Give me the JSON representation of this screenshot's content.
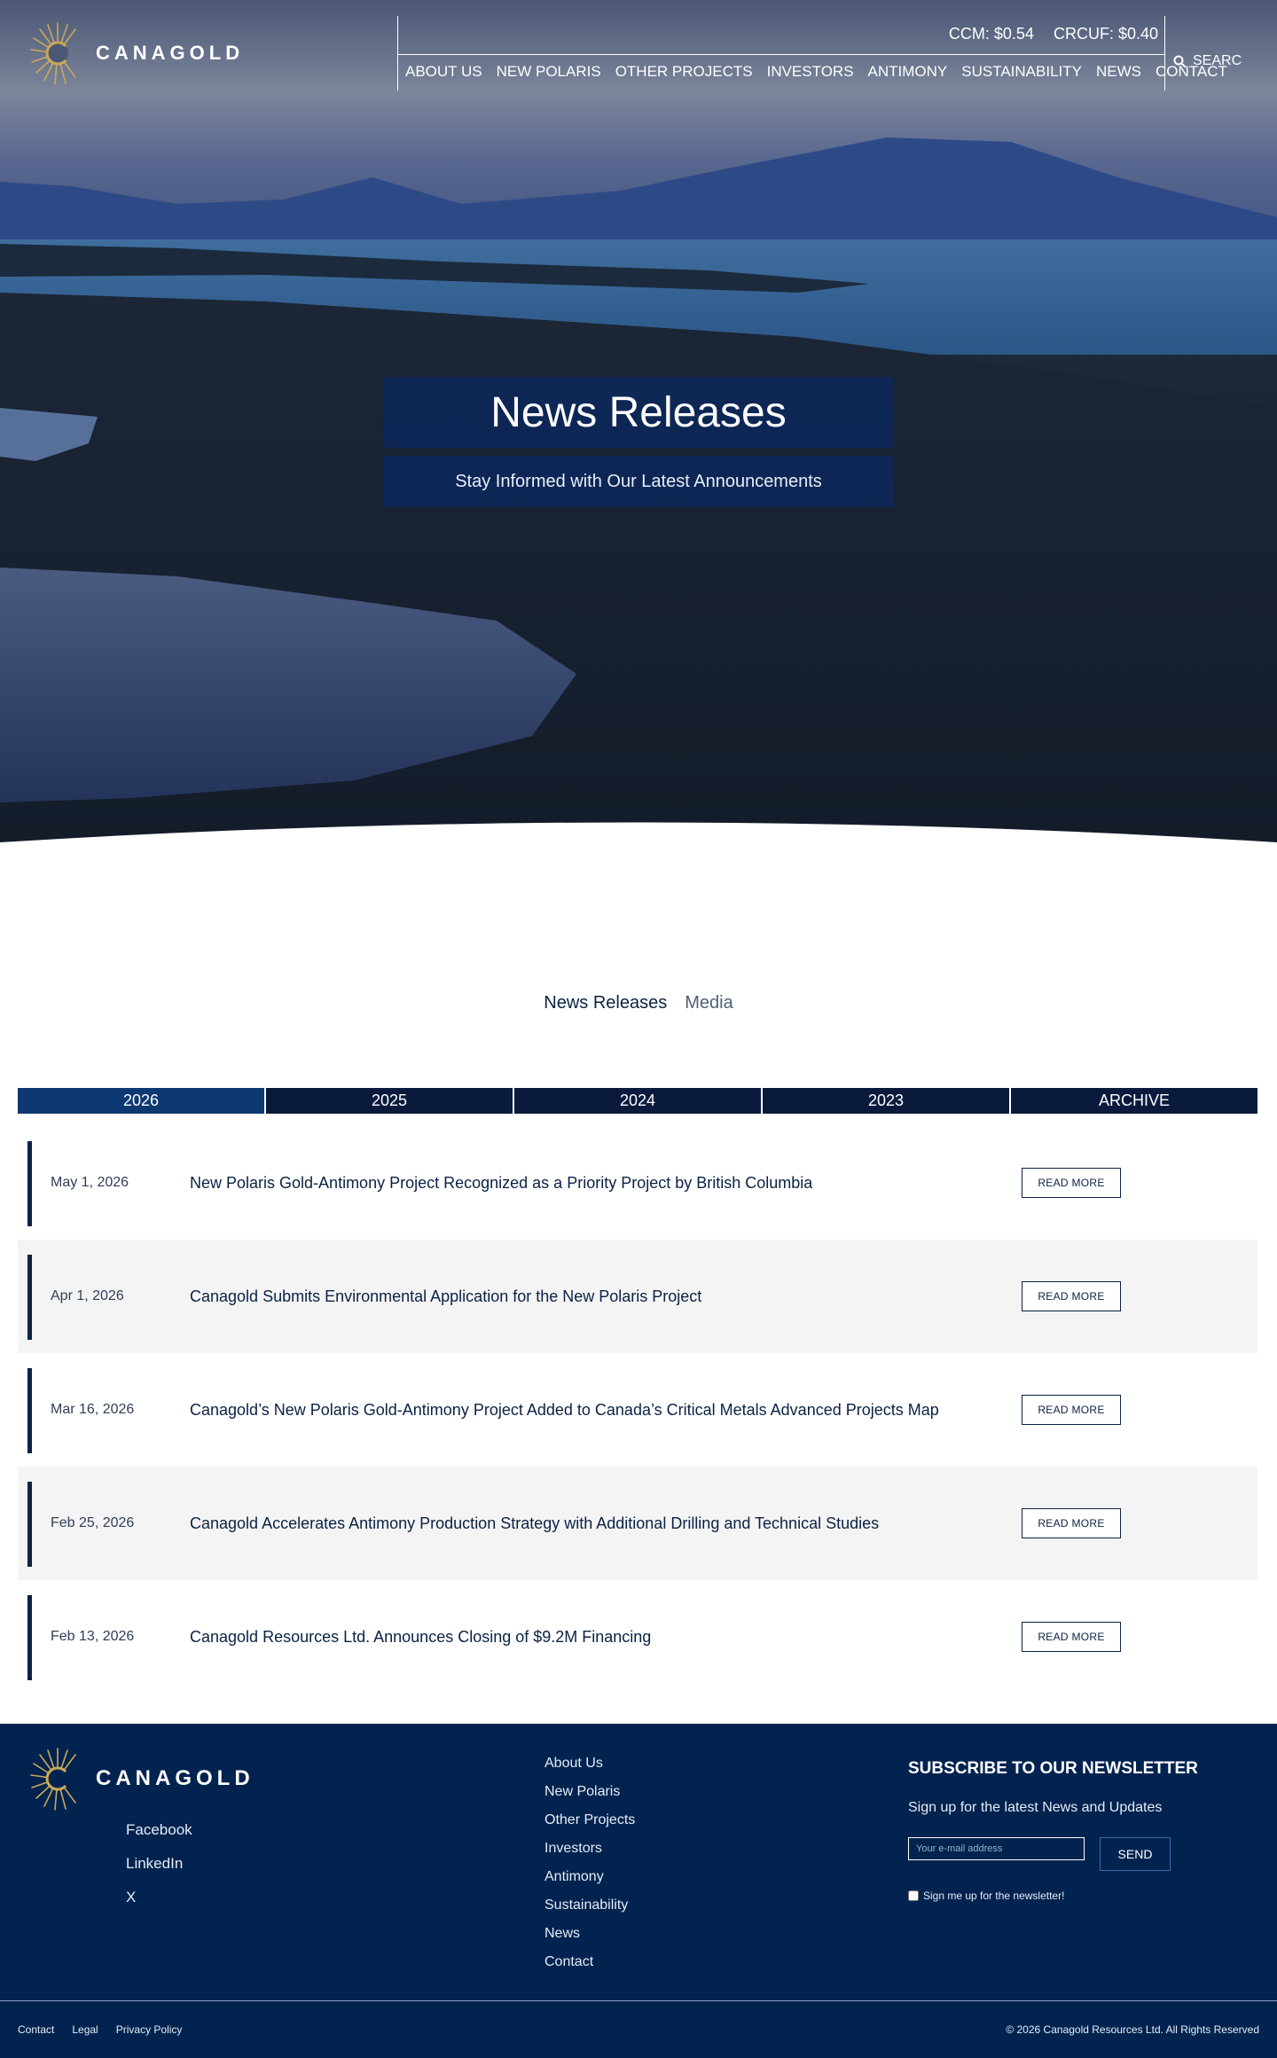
{
  "header": {
    "logo_text": "CANAGOLD",
    "ticker": [
      {
        "label": "CCM: $0.54"
      },
      {
        "label": "CRCUF: $0.40"
      }
    ],
    "nav": [
      "ABOUT US",
      "NEW POLARIS",
      "OTHER PROJECTS",
      "INVESTORS",
      "ANTIMONY",
      "SUSTAINABILITY",
      "NEWS",
      "CONTACT"
    ],
    "search_label": "SEARC"
  },
  "hero": {
    "title": "News Releases",
    "subtitle": "Stay Informed with Our Latest Announcements"
  },
  "tabs": {
    "active": "News Releases",
    "other": "Media"
  },
  "years": [
    "2026",
    "2025",
    "2024",
    "2023",
    "ARCHIVE"
  ],
  "news": [
    {
      "date": "May 1, 2026",
      "title": "New Polaris Gold-Antimony Project Recognized as a Priority Project by British Columbia",
      "button": "READ MORE"
    },
    {
      "date": "Apr 1, 2026",
      "title": "Canagold Submits Environmental Application for the New Polaris Project",
      "button": "READ MORE"
    },
    {
      "date": "Mar 16, 2026",
      "title": "Canagold’s New Polaris Gold-Antimony Project Added to Canada’s Critical Metals Advanced Projects Map",
      "button": "READ MORE"
    },
    {
      "date": "Feb 25, 2026",
      "title": "Canagold Accelerates Antimony Production Strategy with Additional Drilling and Technical Studies",
      "button": "READ MORE"
    },
    {
      "date": "Feb 13, 2026",
      "title": "Canagold Resources Ltd. Announces Closing of $9.2M Financing",
      "button": "READ MORE"
    }
  ],
  "footer": {
    "logo_text": "CANAGOLD",
    "social": [
      "Facebook",
      "LinkedIn",
      "X"
    ],
    "nav": [
      "About Us",
      "New Polaris",
      "Other Projects",
      "Investors",
      "Antimony",
      "Sustainability",
      "News",
      "Contact"
    ],
    "newsletter": {
      "title": "SUBSCRIBE TO OUR NEWSLETTER",
      "subtitle": "Sign up for the latest News and Updates",
      "placeholder": "Your e-mail address",
      "button": "SEND",
      "checkbox_label": "Sign me up for the newsletter!"
    },
    "bottom_links": [
      "Contact",
      "Legal",
      "Privacy Policy"
    ],
    "copyright": "© 2026 Canagold Resources Ltd. All Rights Reserved"
  },
  "colors": {
    "navy": "#0a2244",
    "footer_bg": "#02234f",
    "year_bg": "#0a1a3c",
    "year_active": "#0e3872",
    "gold": "#c9a85a"
  },
  "icons": [
    "canagold-logo-icon",
    "search-icon"
  ]
}
